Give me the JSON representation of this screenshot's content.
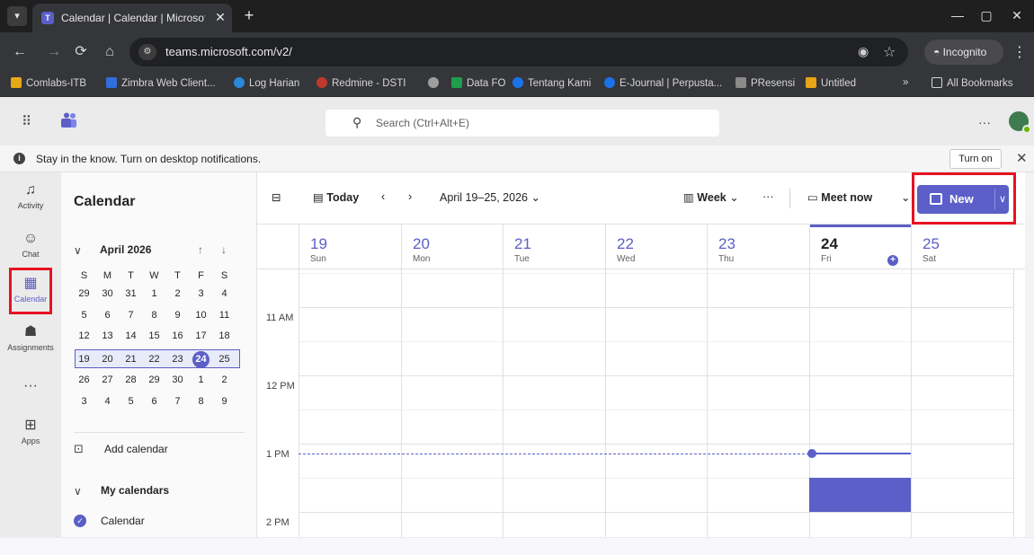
{
  "browser": {
    "tab_title": "Calendar | Calendar | Microsoft",
    "tab_close": "✕",
    "new_tab": "+",
    "url": "teams.microsoft.com/v2/",
    "incognito_label": "Incognito",
    "window_buttons": [
      "—",
      "▢",
      "✕"
    ],
    "bookmarks": [
      {
        "label": "Comlabs-ITB",
        "color": "#e6a817"
      },
      {
        "label": "Zimbra Web Client...",
        "color": "#2f6fdb"
      },
      {
        "label": "Log Harian",
        "color": "#2b88d8"
      },
      {
        "label": "Redmine - DSTI",
        "color": "#c0392b"
      },
      {
        "label": "",
        "color": "#9e9e9e"
      },
      {
        "label": "Data FO",
        "color": "#1e9e4a"
      },
      {
        "label": "Tentang Kami",
        "color": "#1a73e8"
      },
      {
        "label": "E-Journal | Perpusta...",
        "color": "#1a73e8"
      },
      {
        "label": "PResensi",
        "color": "#8a8a8a"
      },
      {
        "label": "Untitled",
        "color": "#e8a317"
      }
    ],
    "bookmarks_overflow": "»",
    "all_bookmarks": "All Bookmarks"
  },
  "teams": {
    "search_placeholder": "Search (Ctrl+Alt+E)",
    "more": "···"
  },
  "notification": {
    "message": "Stay in the know. Turn on desktop notifications.",
    "turn_on": "Turn on"
  },
  "rail": [
    {
      "label": "Activity",
      "icon": "bell-icon"
    },
    {
      "label": "Chat",
      "icon": "chat-icon"
    },
    {
      "label": "Calendar",
      "icon": "calendar-icon"
    },
    {
      "label": "Assignments",
      "icon": "backpack-icon"
    },
    {
      "label": "",
      "icon": "more-icon"
    },
    {
      "label": "Apps",
      "icon": "plus-box-icon"
    }
  ],
  "sidebar": {
    "title": "Calendar",
    "month_label": "April 2026",
    "weekday_headers": [
      "S",
      "M",
      "T",
      "W",
      "T",
      "F",
      "S"
    ],
    "weeks": [
      [
        "29",
        "30",
        "31",
        "1",
        "2",
        "3",
        "4"
      ],
      [
        "5",
        "6",
        "7",
        "8",
        "9",
        "10",
        "11"
      ],
      [
        "12",
        "13",
        "14",
        "15",
        "16",
        "17",
        "18"
      ],
      [
        "19",
        "20",
        "21",
        "22",
        "23",
        "24",
        "25"
      ],
      [
        "26",
        "27",
        "28",
        "29",
        "30",
        "1",
        "2"
      ],
      [
        "3",
        "4",
        "5",
        "6",
        "7",
        "8",
        "9"
      ]
    ],
    "selected_week_index": 3,
    "today": "24",
    "add_calendar": "Add calendar",
    "my_calendars": "My calendars",
    "calendar_item": "Calendar"
  },
  "toolbar": {
    "today": "Today",
    "date_range": "April 19–25, 2026",
    "view": "Week",
    "more": "···",
    "meet_now": "Meet now",
    "new": "New"
  },
  "days": [
    {
      "num": "19",
      "name": "Sun"
    },
    {
      "num": "20",
      "name": "Mon"
    },
    {
      "num": "21",
      "name": "Tue"
    },
    {
      "num": "22",
      "name": "Wed"
    },
    {
      "num": "23",
      "name": "Thu"
    },
    {
      "num": "24",
      "name": "Fri"
    },
    {
      "num": "25",
      "name": "Sat"
    }
  ],
  "today_index": 5,
  "time_labels": [
    "11 AM",
    "12 PM",
    "1 PM",
    "2 PM"
  ],
  "colors": {
    "accent": "#5b5fc7",
    "highlight": "#e81123"
  }
}
